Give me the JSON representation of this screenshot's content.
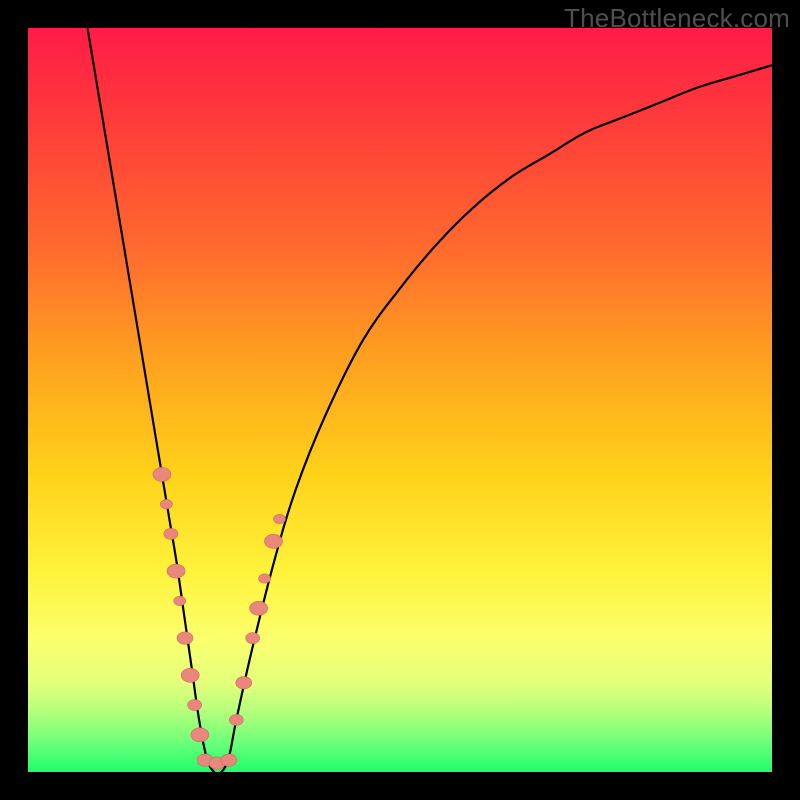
{
  "watermark": "TheBottleneck.com",
  "colors": {
    "frame": "#000000",
    "curve": "#000000",
    "marker_fill": "#e9877d",
    "marker_stroke": "#c96a60"
  },
  "chart_data": {
    "type": "line",
    "title": "",
    "xlabel": "",
    "ylabel": "",
    "xlim": [
      0,
      100
    ],
    "ylim": [
      0,
      100
    ],
    "grid": false,
    "legend": false,
    "series": [
      {
        "name": "bottleneck-curve",
        "x": [
          8,
          10,
          12,
          14,
          16,
          18,
          19,
          20,
          21,
          22,
          23,
          24,
          25,
          26,
          27,
          28,
          30,
          33,
          36,
          40,
          45,
          50,
          55,
          60,
          65,
          70,
          75,
          80,
          85,
          90,
          95,
          100
        ],
        "y": [
          100,
          88,
          76,
          64,
          52,
          40,
          34,
          28,
          21,
          14,
          7,
          2,
          0,
          0,
          2,
          7,
          16,
          28,
          38,
          48,
          58,
          65,
          71,
          76,
          80,
          83,
          86,
          88,
          90,
          92,
          93.5,
          95
        ]
      }
    ],
    "markers_left": {
      "name": "left-cluster",
      "points": [
        {
          "x": 18.0,
          "y": 40,
          "r": 9
        },
        {
          "x": 18.6,
          "y": 36,
          "r": 6
        },
        {
          "x": 19.2,
          "y": 32,
          "r": 7
        },
        {
          "x": 19.9,
          "y": 27,
          "r": 9
        },
        {
          "x": 20.4,
          "y": 23,
          "r": 6
        },
        {
          "x": 21.1,
          "y": 18,
          "r": 8
        },
        {
          "x": 21.8,
          "y": 13,
          "r": 9
        },
        {
          "x": 22.4,
          "y": 9,
          "r": 7
        },
        {
          "x": 23.1,
          "y": 5,
          "r": 9
        }
      ]
    },
    "markers_right": {
      "name": "right-cluster",
      "points": [
        {
          "x": 28.0,
          "y": 7,
          "r": 7
        },
        {
          "x": 29.0,
          "y": 12,
          "r": 8
        },
        {
          "x": 30.2,
          "y": 18,
          "r": 7
        },
        {
          "x": 31.0,
          "y": 22,
          "r": 9
        },
        {
          "x": 31.8,
          "y": 26,
          "r": 6
        },
        {
          "x": 33.0,
          "y": 31,
          "r": 9
        },
        {
          "x": 33.8,
          "y": 34,
          "r": 6
        }
      ]
    },
    "markers_bottom": {
      "name": "bottom-cluster",
      "points": [
        {
          "x": 23.8,
          "y": 1.6,
          "r": 8
        },
        {
          "x": 25.4,
          "y": 1.2,
          "r": 8
        },
        {
          "x": 27.0,
          "y": 1.6,
          "r": 8
        }
      ]
    }
  }
}
